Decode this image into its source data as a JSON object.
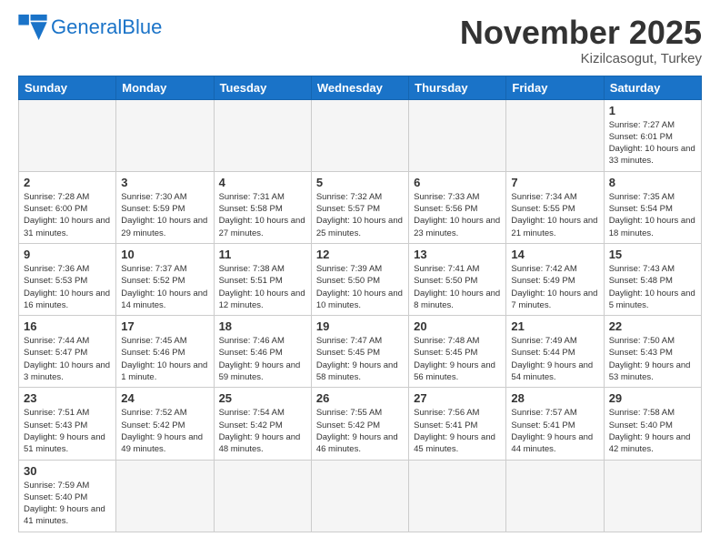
{
  "header": {
    "logo_general": "General",
    "logo_blue": "Blue",
    "month_title": "November 2025",
    "location": "Kizilcasogut, Turkey"
  },
  "days_of_week": [
    "Sunday",
    "Monday",
    "Tuesday",
    "Wednesday",
    "Thursday",
    "Friday",
    "Saturday"
  ],
  "weeks": [
    [
      {
        "day": "",
        "info": ""
      },
      {
        "day": "",
        "info": ""
      },
      {
        "day": "",
        "info": ""
      },
      {
        "day": "",
        "info": ""
      },
      {
        "day": "",
        "info": ""
      },
      {
        "day": "",
        "info": ""
      },
      {
        "day": "1",
        "info": "Sunrise: 7:27 AM\nSunset: 6:01 PM\nDaylight: 10 hours and 33 minutes."
      }
    ],
    [
      {
        "day": "2",
        "info": "Sunrise: 7:28 AM\nSunset: 6:00 PM\nDaylight: 10 hours and 31 minutes."
      },
      {
        "day": "3",
        "info": "Sunrise: 7:30 AM\nSunset: 5:59 PM\nDaylight: 10 hours and 29 minutes."
      },
      {
        "day": "4",
        "info": "Sunrise: 7:31 AM\nSunset: 5:58 PM\nDaylight: 10 hours and 27 minutes."
      },
      {
        "day": "5",
        "info": "Sunrise: 7:32 AM\nSunset: 5:57 PM\nDaylight: 10 hours and 25 minutes."
      },
      {
        "day": "6",
        "info": "Sunrise: 7:33 AM\nSunset: 5:56 PM\nDaylight: 10 hours and 23 minutes."
      },
      {
        "day": "7",
        "info": "Sunrise: 7:34 AM\nSunset: 5:55 PM\nDaylight: 10 hours and 21 minutes."
      },
      {
        "day": "8",
        "info": "Sunrise: 7:35 AM\nSunset: 5:54 PM\nDaylight: 10 hours and 18 minutes."
      }
    ],
    [
      {
        "day": "9",
        "info": "Sunrise: 7:36 AM\nSunset: 5:53 PM\nDaylight: 10 hours and 16 minutes."
      },
      {
        "day": "10",
        "info": "Sunrise: 7:37 AM\nSunset: 5:52 PM\nDaylight: 10 hours and 14 minutes."
      },
      {
        "day": "11",
        "info": "Sunrise: 7:38 AM\nSunset: 5:51 PM\nDaylight: 10 hours and 12 minutes."
      },
      {
        "day": "12",
        "info": "Sunrise: 7:39 AM\nSunset: 5:50 PM\nDaylight: 10 hours and 10 minutes."
      },
      {
        "day": "13",
        "info": "Sunrise: 7:41 AM\nSunset: 5:50 PM\nDaylight: 10 hours and 8 minutes."
      },
      {
        "day": "14",
        "info": "Sunrise: 7:42 AM\nSunset: 5:49 PM\nDaylight: 10 hours and 7 minutes."
      },
      {
        "day": "15",
        "info": "Sunrise: 7:43 AM\nSunset: 5:48 PM\nDaylight: 10 hours and 5 minutes."
      }
    ],
    [
      {
        "day": "16",
        "info": "Sunrise: 7:44 AM\nSunset: 5:47 PM\nDaylight: 10 hours and 3 minutes."
      },
      {
        "day": "17",
        "info": "Sunrise: 7:45 AM\nSunset: 5:46 PM\nDaylight: 10 hours and 1 minute."
      },
      {
        "day": "18",
        "info": "Sunrise: 7:46 AM\nSunset: 5:46 PM\nDaylight: 9 hours and 59 minutes."
      },
      {
        "day": "19",
        "info": "Sunrise: 7:47 AM\nSunset: 5:45 PM\nDaylight: 9 hours and 58 minutes."
      },
      {
        "day": "20",
        "info": "Sunrise: 7:48 AM\nSunset: 5:45 PM\nDaylight: 9 hours and 56 minutes."
      },
      {
        "day": "21",
        "info": "Sunrise: 7:49 AM\nSunset: 5:44 PM\nDaylight: 9 hours and 54 minutes."
      },
      {
        "day": "22",
        "info": "Sunrise: 7:50 AM\nSunset: 5:43 PM\nDaylight: 9 hours and 53 minutes."
      }
    ],
    [
      {
        "day": "23",
        "info": "Sunrise: 7:51 AM\nSunset: 5:43 PM\nDaylight: 9 hours and 51 minutes."
      },
      {
        "day": "24",
        "info": "Sunrise: 7:52 AM\nSunset: 5:42 PM\nDaylight: 9 hours and 49 minutes."
      },
      {
        "day": "25",
        "info": "Sunrise: 7:54 AM\nSunset: 5:42 PM\nDaylight: 9 hours and 48 minutes."
      },
      {
        "day": "26",
        "info": "Sunrise: 7:55 AM\nSunset: 5:42 PM\nDaylight: 9 hours and 46 minutes."
      },
      {
        "day": "27",
        "info": "Sunrise: 7:56 AM\nSunset: 5:41 PM\nDaylight: 9 hours and 45 minutes."
      },
      {
        "day": "28",
        "info": "Sunrise: 7:57 AM\nSunset: 5:41 PM\nDaylight: 9 hours and 44 minutes."
      },
      {
        "day": "29",
        "info": "Sunrise: 7:58 AM\nSunset: 5:40 PM\nDaylight: 9 hours and 42 minutes."
      }
    ],
    [
      {
        "day": "30",
        "info": "Sunrise: 7:59 AM\nSunset: 5:40 PM\nDaylight: 9 hours and 41 minutes."
      },
      {
        "day": "",
        "info": ""
      },
      {
        "day": "",
        "info": ""
      },
      {
        "day": "",
        "info": ""
      },
      {
        "day": "",
        "info": ""
      },
      {
        "day": "",
        "info": ""
      },
      {
        "day": "",
        "info": ""
      }
    ]
  ]
}
